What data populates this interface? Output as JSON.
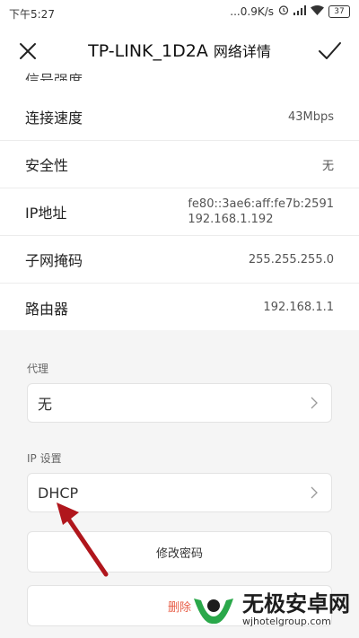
{
  "status_bar": {
    "time": "下午5:27",
    "network_speed": "...0.9K/s",
    "battery": "37"
  },
  "header": {
    "title": "TP-LINK_1D2A",
    "subtitle": "网络详情"
  },
  "partial_row_label": "信号强度",
  "details": [
    {
      "label": "连接速度",
      "value": "43Mbps"
    },
    {
      "label": "安全性",
      "value": "无"
    },
    {
      "label": "IP地址",
      "value_line1": "fe80::3ae6:aff:fe7b:2591",
      "value_line2": "192.168.1.192"
    },
    {
      "label": "子网掩码",
      "value": "255.255.255.0"
    },
    {
      "label": "路由器",
      "value": "192.168.1.1"
    }
  ],
  "proxy": {
    "label": "代理",
    "value": "无"
  },
  "ip_settings": {
    "label": "IP 设置",
    "value": "DHCP"
  },
  "buttons": {
    "change_password": "修改密码",
    "delete": "删除"
  },
  "watermark": {
    "name": "无极安卓网",
    "url": "wjhotelgroup.com"
  },
  "colors": {
    "delete_red": "#e8604a",
    "arrow_red": "#b0161c",
    "watermark_green": "#2aa84a"
  }
}
